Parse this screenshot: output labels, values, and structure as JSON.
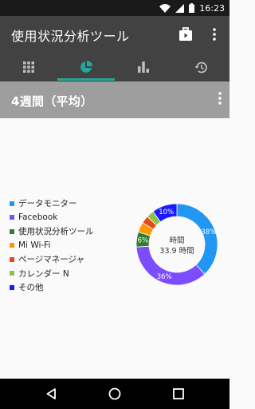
{
  "status_bar": {
    "time": "16:23",
    "icons": [
      "wifi-icon",
      "signal-icon",
      "battery-icon"
    ]
  },
  "app_bar": {
    "title": "使用状況分析ツール",
    "actions": [
      "work-briefcase-icon",
      "more-vert-icon"
    ]
  },
  "tabs": [
    {
      "icon": "grid-icon",
      "selected": false
    },
    {
      "icon": "pie-chart-icon",
      "selected": true
    },
    {
      "icon": "bar-chart-icon",
      "selected": false
    },
    {
      "icon": "history-icon",
      "selected": false
    }
  ],
  "section": {
    "title": "4週間（平均）"
  },
  "colors": {
    "accent": "#26a69a",
    "appbar": "#424242",
    "section": "#9e9e9e"
  },
  "chart_data": {
    "type": "pie",
    "center_label_1": "時間",
    "center_label_2": "33.9 時間",
    "slices": [
      {
        "name": "データモニター",
        "value": 38,
        "label": "38%",
        "color": "#2196f3"
      },
      {
        "name": "Facebook",
        "value": 36,
        "label": "36%",
        "color": "#7c4dff"
      },
      {
        "name": "使用状況分析ツール",
        "value": 6,
        "label": "6%",
        "color": "#2e7d32"
      },
      {
        "name": "Mi Wi-Fi",
        "value": 4,
        "label": "",
        "color": "#ff9800"
      },
      {
        "name": "ページマネージャ",
        "value": 3,
        "label": "",
        "color": "#e64a19"
      },
      {
        "name": "カレンダー N",
        "value": 3,
        "label": "",
        "color": "#8bc34a"
      },
      {
        "name": "その他",
        "value": 10,
        "label": "10%",
        "color": "#1a1aff"
      }
    ]
  },
  "nav_bar": {
    "buttons": [
      "back-icon",
      "home-icon",
      "recents-icon"
    ]
  }
}
